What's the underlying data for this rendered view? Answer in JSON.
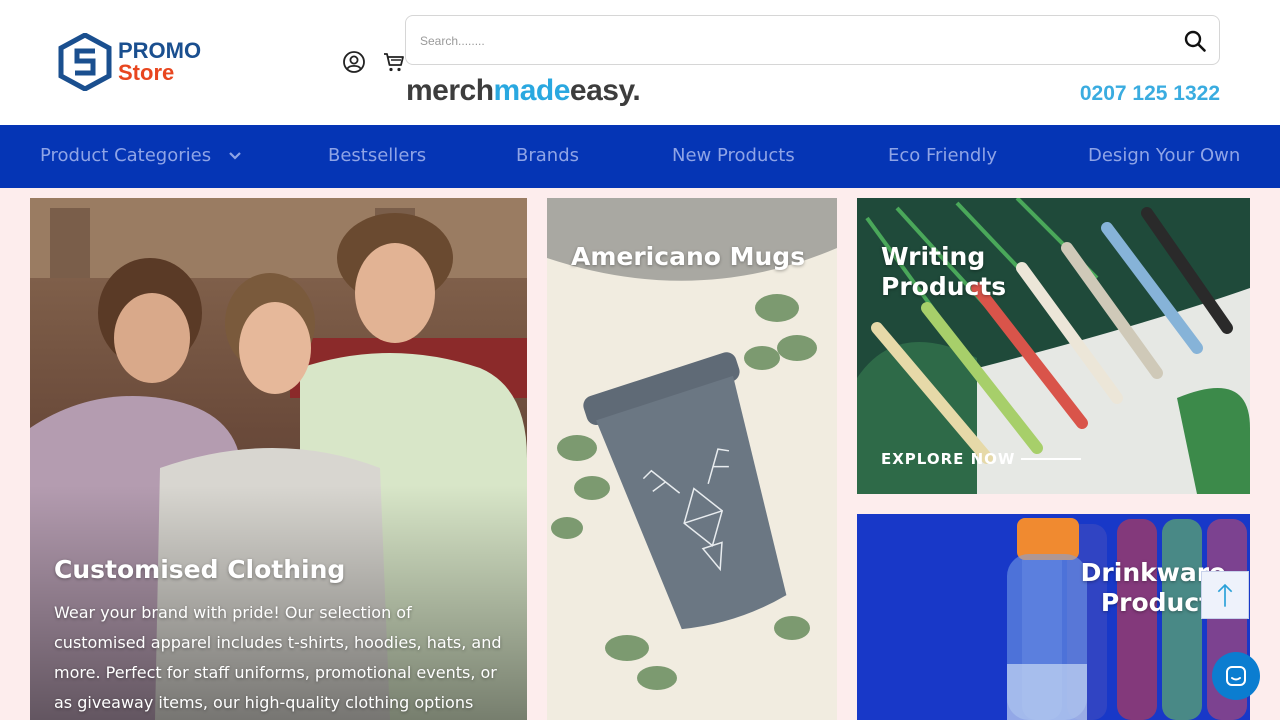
{
  "brand": {
    "line1": "PROMO",
    "line2": "Store"
  },
  "search": {
    "placeholder": "Search........"
  },
  "merch_logo": {
    "part1": "merch",
    "part2": "made",
    "part3": "easy."
  },
  "phone": "0207 125 1322",
  "nav": [
    {
      "label": "Product Categories",
      "has_dropdown": true
    },
    {
      "label": "Bestsellers"
    },
    {
      "label": "Brands"
    },
    {
      "label": "New Products"
    },
    {
      "label": "Eco Friendly"
    },
    {
      "label": "Design Your Own"
    }
  ],
  "tiles": {
    "clothing": {
      "title": "Customised Clothing",
      "description": "Wear your brand with pride! Our selection of customised apparel includes t-shirts, hoodies, hats, and more. Perfect for staff uniforms, promotional events, or as giveaway items, our high-quality clothing options are"
    },
    "mugs": {
      "title": "Americano Mugs"
    },
    "writing": {
      "title": "Writing Products",
      "cta": "EXPLORE NOW"
    },
    "drinkware": {
      "title": "Drinkware Products"
    }
  },
  "colors": {
    "nav_bg": "#0535b5",
    "nav_text": "#8fa4e6",
    "phone": "#3aace0",
    "brand_blue": "#1a4f8f",
    "brand_orange": "#e8461f",
    "content_bg": "#fdeded"
  },
  "icons": [
    "user-icon",
    "cart-icon",
    "search-icon",
    "chevron-down-icon",
    "arrow-up-icon",
    "chat-icon"
  ]
}
